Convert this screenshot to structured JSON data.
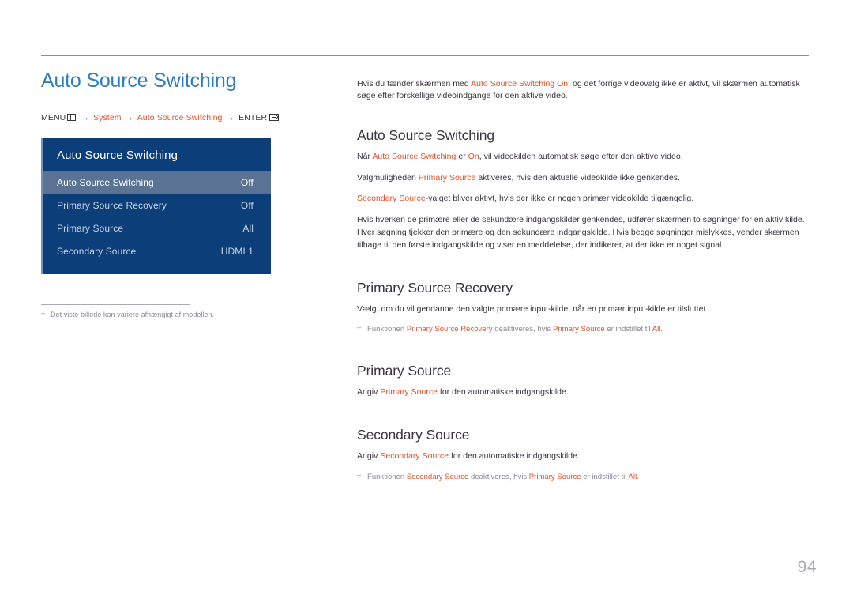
{
  "page": {
    "title": "Auto Source Switching",
    "page_number": "94"
  },
  "breadcrumb": {
    "menu_label": "MENU",
    "menu_icon": "menu-grid-icon",
    "arrow": "→",
    "item1": "System",
    "item2": "Auto Source Switching",
    "enter_label": "ENTER",
    "enter_icon": "enter-key-icon"
  },
  "osd": {
    "title": "Auto Source Switching",
    "rows": [
      {
        "label": "Auto Source Switching",
        "value": "Off",
        "selected": true
      },
      {
        "label": "Primary Source Recovery",
        "value": "Off",
        "selected": false
      },
      {
        "label": "Primary Source",
        "value": "All",
        "selected": false
      },
      {
        "label": "Secondary Source",
        "value": "HDMI 1",
        "selected": false
      }
    ]
  },
  "left_footnote": {
    "marker": "‒",
    "text": "Det viste billede kan variere afhængigt af modellen."
  },
  "intro": {
    "p1_a": "Hvis du tænder skærmen med ",
    "p1_accent": "Auto Source Switching On",
    "p1_b": ", og det forrige videovalg ikke er aktivt, vil skærmen automatisk søge efter forskellige videoindgange for den aktive video."
  },
  "sections": [
    {
      "heading": "Auto Source Switching",
      "paragraphs": [
        {
          "a": "Når ",
          "accent": "Auto Source Switching",
          "b": " er ",
          "accent2": "On",
          "c": ", vil videokilden automatisk søge efter den aktive video."
        },
        {
          "a": "Valgmuligheden ",
          "accent": "Primary Source",
          "b": " aktiveres, hvis den aktuelle videokilde ikke genkendes.",
          "accent2": "",
          "c": ""
        },
        {
          "a": "",
          "accent": "Secondary Source",
          "b": "-valget bliver aktivt, hvis der ikke er nogen primær videokilde tilgængelig.",
          "accent2": "",
          "c": ""
        },
        {
          "a": "Hvis hverken de primære eller de sekundære indgangskilder genkendes, udfører skærmen to søgninger for en aktiv kilde. Hver søgning tjekker den primære og den sekundære indgangskilde. Hvis begge søgninger mislykkes, vender skærmen tilbage til den første indgangskilde og viser en meddelelse, der indikerer, at der ikke er noget signal.",
          "accent": "",
          "b": "",
          "accent2": "",
          "c": ""
        }
      ],
      "note": null
    },
    {
      "heading": "Primary Source Recovery",
      "paragraphs": [
        {
          "a": "Vælg, om du vil gendanne den valgte primære input-kilde, når en primær input-kilde er tilsluttet.",
          "accent": "",
          "b": "",
          "accent2": "",
          "c": ""
        }
      ],
      "note": {
        "marker": "‒",
        "a": "Funktionen ",
        "accent": "Primary Source Recovery",
        "b": " deaktiveres, hvis ",
        "accent2": "Primary Source",
        "c": " er indstillet til ",
        "accent3": "All",
        "d": "."
      }
    },
    {
      "heading": "Primary Source",
      "paragraphs": [
        {
          "a": "Angiv ",
          "accent": "Primary Source",
          "b": " for den automatiske indgangskilde.",
          "accent2": "",
          "c": ""
        }
      ],
      "note": null
    },
    {
      "heading": "Secondary Source",
      "paragraphs": [
        {
          "a": "Angiv ",
          "accent": "Secondary Source",
          "b": " for den automatiske indgangskilde.",
          "accent2": "",
          "c": ""
        }
      ],
      "note": {
        "marker": "‒",
        "a": "Funktionen ",
        "accent": "Secondary Source",
        "b": " deaktiveres, hvis ",
        "accent2": "Primary Source",
        "c": " er indstillet til ",
        "accent3": "All",
        "d": "."
      }
    }
  ],
  "colors": {
    "title_blue": "#2d7fc1",
    "accent_orange": "#e0512a",
    "body_text": "#3a3340",
    "osd_bg": "#0c3f79",
    "osd_selected": "#5a7394",
    "note_gray": "#8a8895"
  }
}
